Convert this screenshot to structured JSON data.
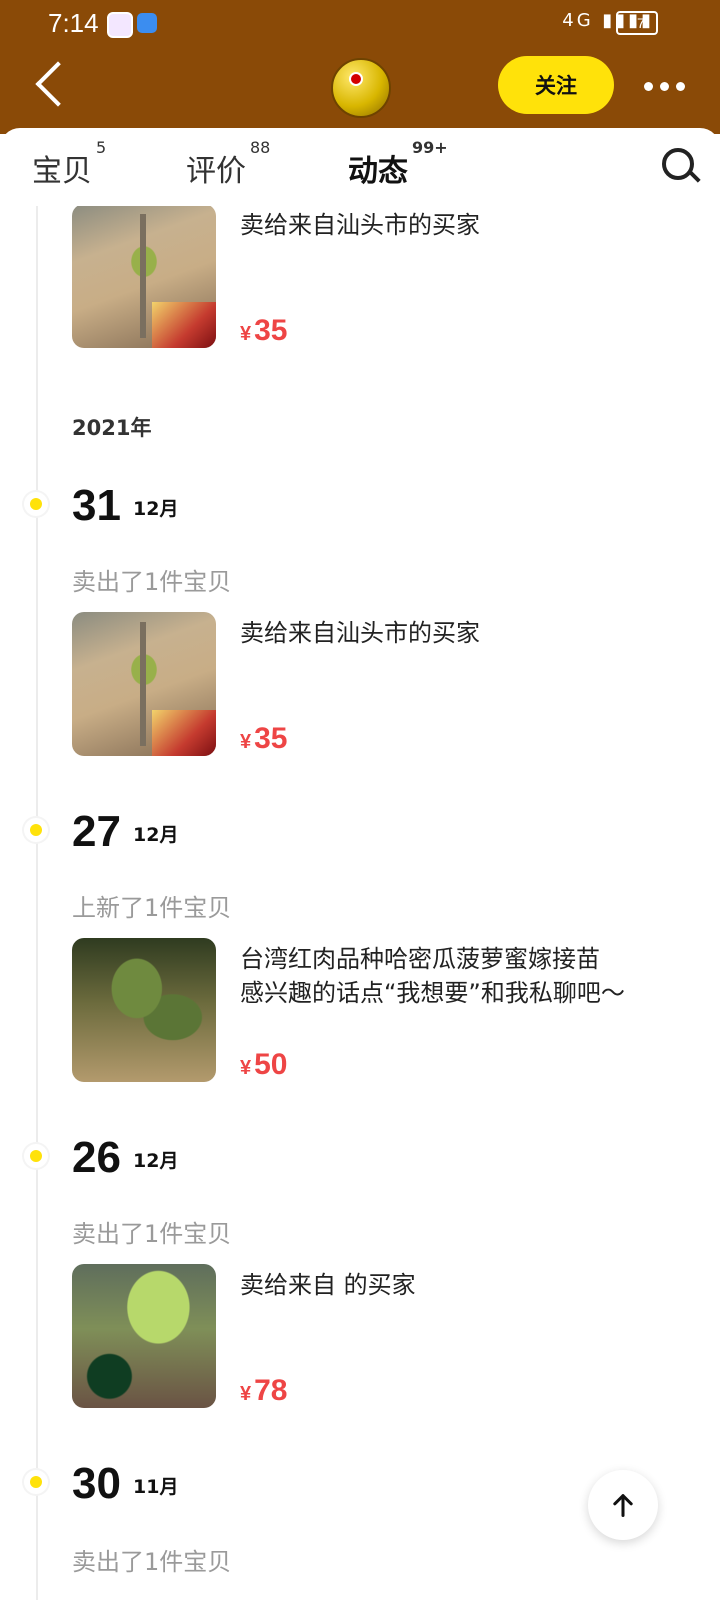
{
  "status": {
    "time": "7:14",
    "signal": "4G",
    "battery": "67"
  },
  "header": {
    "follow_label": "关注"
  },
  "tabs": [
    {
      "label": "宝贝",
      "count": "5"
    },
    {
      "label": "评价",
      "count": "88"
    },
    {
      "label": "动态",
      "count": "99+"
    }
  ],
  "feed": {
    "top_item": {
      "title": "卖给来自汕头市的买家",
      "currency": "¥",
      "price": "35"
    },
    "year": "2021年",
    "entries": [
      {
        "day": "31",
        "month": "12月",
        "action": "卖出了1件宝贝",
        "title": "卖给来自汕头市的买家",
        "currency": "¥",
        "price": "35"
      },
      {
        "day": "27",
        "month": "12月",
        "action": "上新了1件宝贝",
        "title": "台湾红肉品种哈密瓜菠萝蜜嫁接苗\n感兴趣的话点“我想要”和我私聊吧～",
        "currency": "¥",
        "price": "50"
      },
      {
        "day": "26",
        "month": "12月",
        "action": "卖出了1件宝贝",
        "title": "卖给来自 的买家",
        "currency": "¥",
        "price": "78"
      },
      {
        "day": "30",
        "month": "11月",
        "action": "卖出了1件宝贝"
      }
    ]
  },
  "icons": {
    "back": "back-icon",
    "more": "more-icon",
    "search": "search-icon",
    "top": "arrow-up-icon"
  }
}
